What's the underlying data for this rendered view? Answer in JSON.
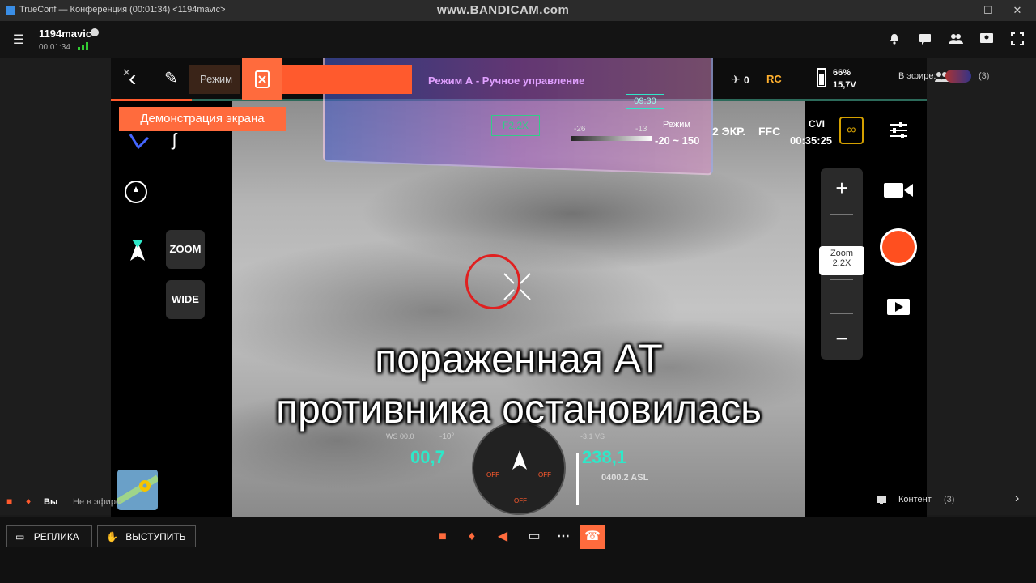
{
  "window": {
    "title": "TrueConf — Конференция (00:01:34) <1194mavic>",
    "watermark": "www.BANDICAM.com",
    "minimize": "—",
    "maximize": "☐",
    "close": "✕"
  },
  "header": {
    "menu_icon": "☰",
    "room_name": "1194mavic",
    "timer": "00:01:34",
    "icons": [
      "bell-icon",
      "chat-icon",
      "participants-icon",
      "share-icon",
      "fullscreen-icon"
    ]
  },
  "share_label": "Демонстрация экрана",
  "drone": {
    "mode_text": "Режим А - Ручное управление",
    "mode_short": "Режим",
    "time_remaining": "09:30",
    "satellites": "0",
    "rc_label": "RC",
    "battery_pct": "66%",
    "battery_voltage": "15,7V",
    "zoom_box": "F2.2X",
    "scale_min": "-26",
    "scale_max": "-13",
    "range_label": "Режим",
    "range_value": "-20 ~ 150",
    "split_label": "2 ЭКР.",
    "ffc_label": "FFC",
    "cvi_label": "CVI",
    "record_time": "00:35:25",
    "zoom_btn": "ZOOM",
    "wide_btn": "WIDE",
    "zoom_title": "Zoom",
    "zoom_value": "2.2X",
    "plus": "+",
    "minus": "−",
    "ws_label": "WS 00.0",
    "pitch_label": "-10°",
    "vs_label": "-3.1 VS",
    "spd_value": "00,7",
    "alt_value": "238,1",
    "asl_label": "0400.2 ASL",
    "compass_off_1": "OFF",
    "compass_off_2": "OFF",
    "compass_off_3": "OFF"
  },
  "caption": {
    "line1": "пораженная АТ",
    "line2": "противника остановилась"
  },
  "on_air": {
    "label": "В эфире:",
    "count": "(3)"
  },
  "self": {
    "name": "Вы",
    "status": "Не в эфире"
  },
  "content": {
    "label": "Контент",
    "count": "(3)"
  },
  "bottom": {
    "reply": "РЕПЛИКА",
    "speak": "ВЫСТУПИТЬ"
  },
  "colors": {
    "accent": "#ff6b3d",
    "hud": "#2ee8c9",
    "target_ring": "#e02020"
  }
}
